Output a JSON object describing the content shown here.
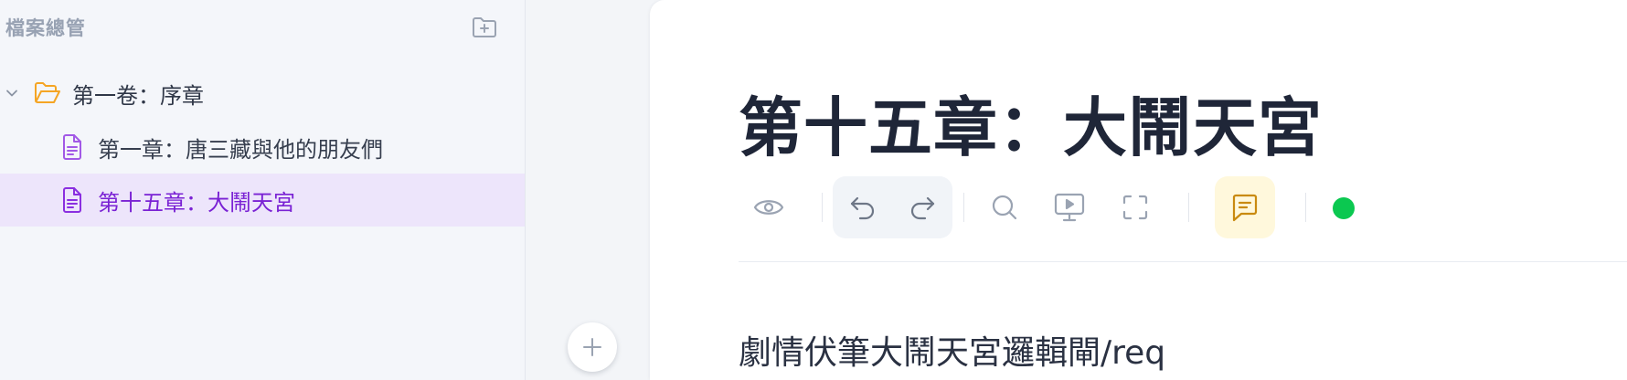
{
  "sidebar": {
    "title": "檔案總管",
    "new_folder_icon": "folder-plus-icon",
    "tree": [
      {
        "type": "folder",
        "label": "第一卷：序章",
        "expanded": true,
        "icon": "folder-open-icon"
      },
      {
        "type": "document",
        "label": "第一章：唐三藏與他的朋友們",
        "icon": "document-icon",
        "selected": false
      },
      {
        "type": "document",
        "label": "第十五章：大鬧天宮",
        "icon": "document-icon",
        "selected": true
      }
    ],
    "add_icon": "plus-icon"
  },
  "editor": {
    "title": "第十五章：大鬧天宮",
    "toolbar": {
      "preview_icon": "eye-icon",
      "undo_icon": "undo-icon",
      "redo_icon": "redo-icon",
      "search_icon": "search-icon",
      "present_icon": "presentation-icon",
      "fullscreen_icon": "fullscreen-icon",
      "comment_icon": "comment-icon",
      "status_color": "#0bc850"
    },
    "content": "劇情伏筆大鬧天宮邏輯閘/req"
  },
  "colors": {
    "accent_purple": "#7a22d4",
    "selected_bg": "#ede5fb",
    "folder_orange": "#f5a524",
    "doc_purple": "#a259e6",
    "comment_bg": "#fff8dc",
    "comment_icon": "#c98a10"
  }
}
